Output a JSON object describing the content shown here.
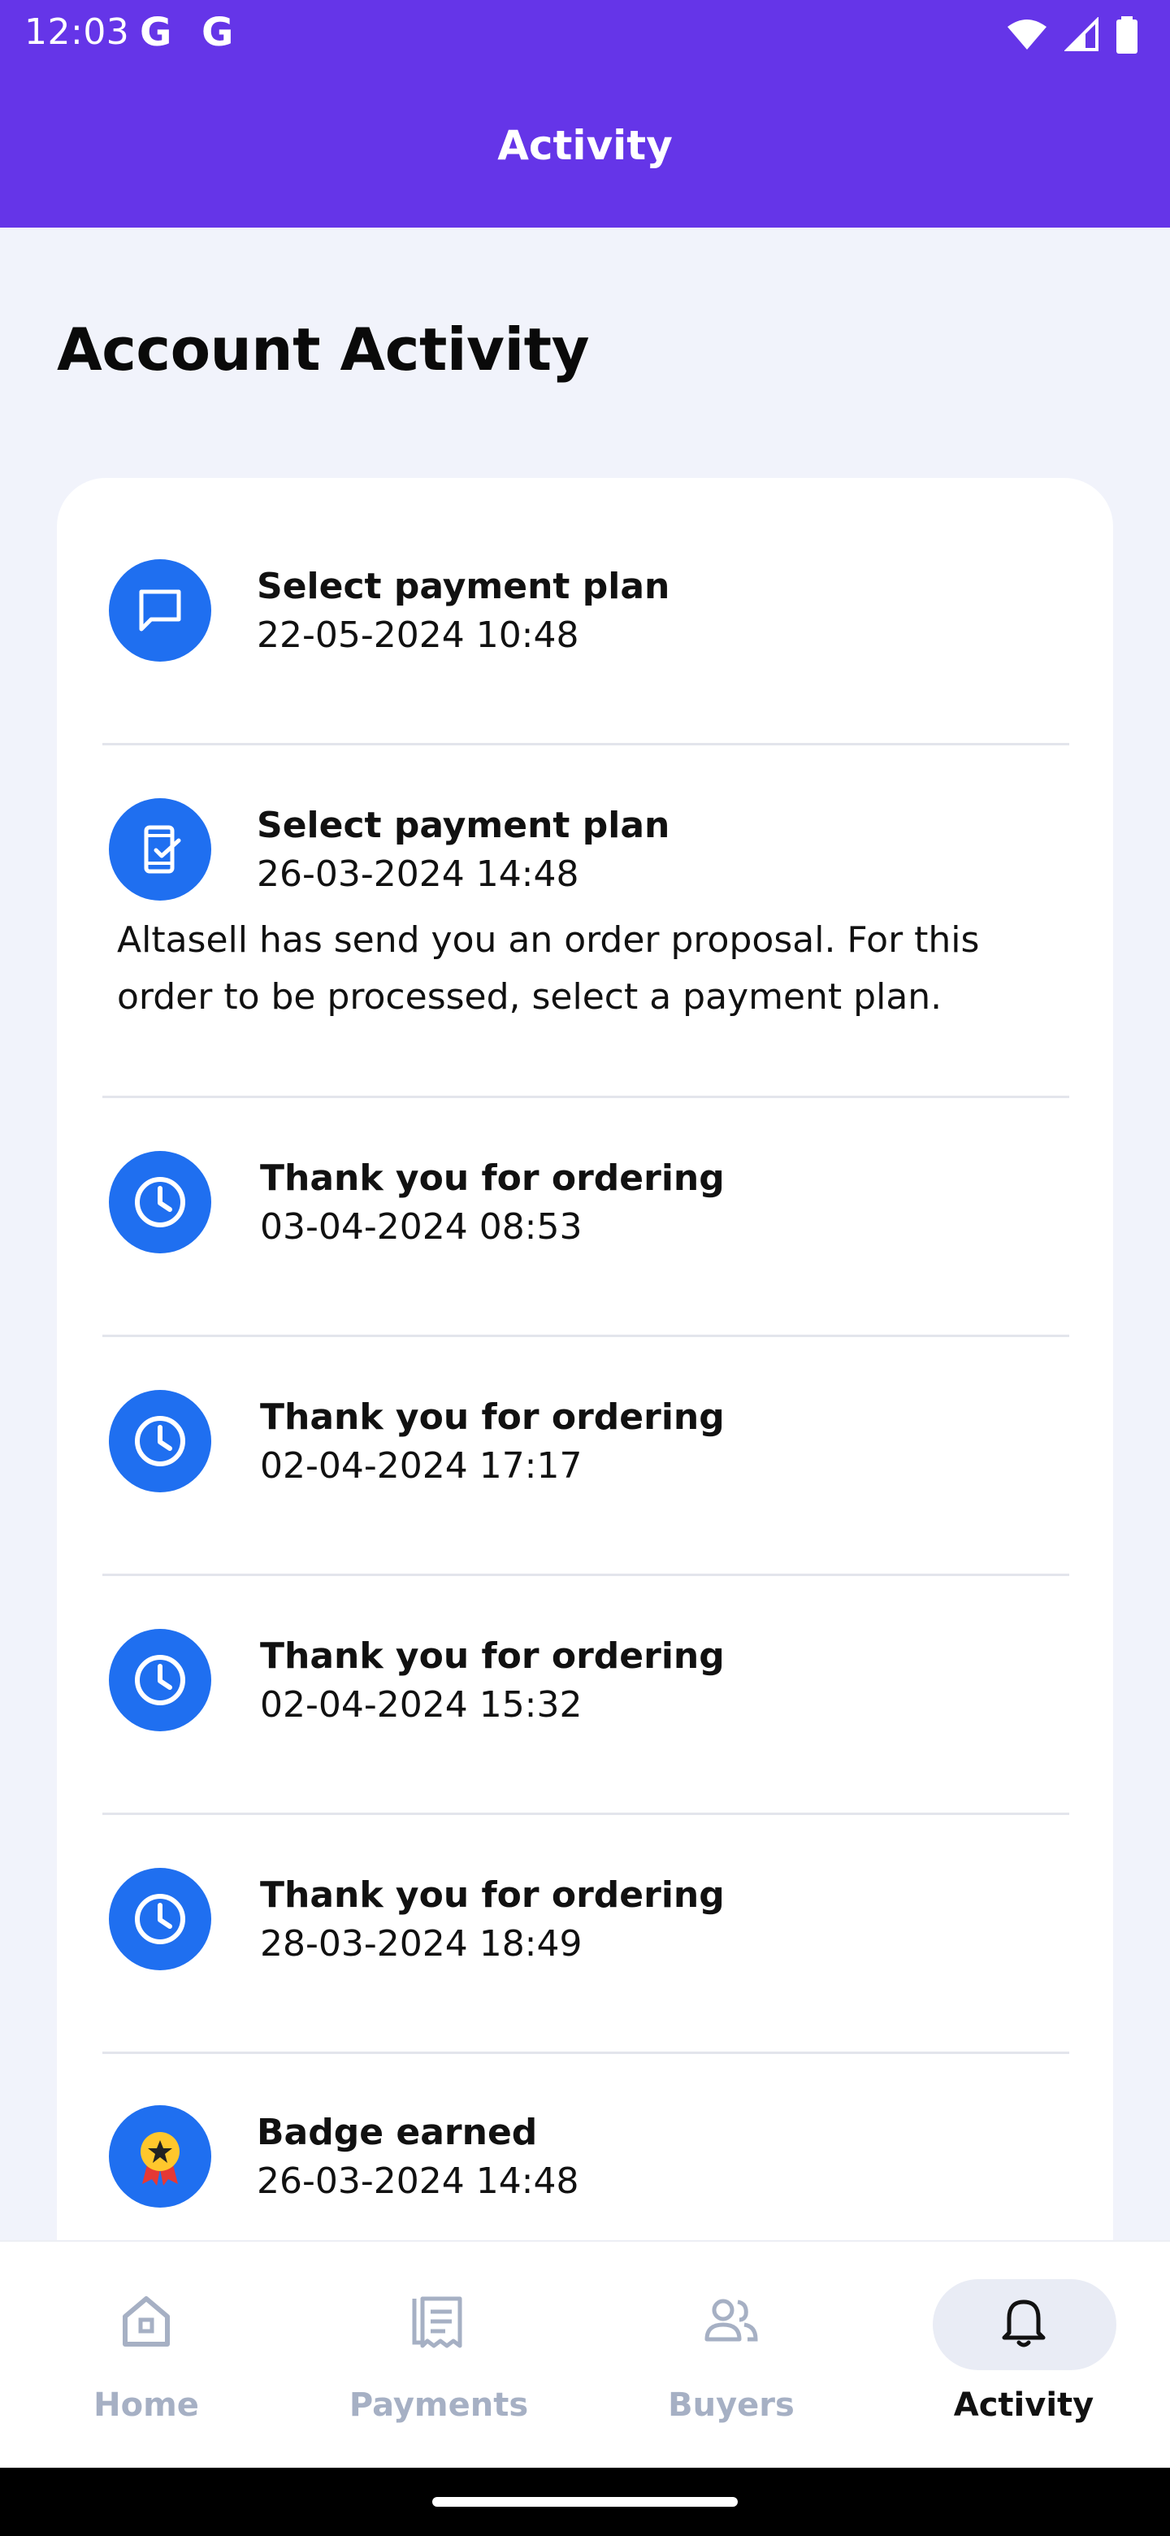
{
  "status_bar": {
    "time": "12:03",
    "google_icons": [
      "G",
      "G"
    ]
  },
  "header": {
    "title": "Activity",
    "color": "#6535e8"
  },
  "page": {
    "section_title": "Account Activity"
  },
  "activities": [
    {
      "icon": "chat-icon",
      "title": "Select payment plan",
      "date": "22-05-2024 10:48"
    },
    {
      "icon": "phone-check-icon",
      "title": "Select payment plan",
      "date": "26-03-2024 14:48",
      "description": "Altasell has send you an order proposal. For this order to be processed, select a payment plan."
    },
    {
      "icon": "clock-icon",
      "title": "Thank you for ordering",
      "date": "03-04-2024 08:53"
    },
    {
      "icon": "clock-icon",
      "title": "Thank you for ordering",
      "date": "02-04-2024 17:17"
    },
    {
      "icon": "clock-icon",
      "title": "Thank you for ordering",
      "date": "02-04-2024 15:32"
    },
    {
      "icon": "clock-icon",
      "title": "Thank you for ordering",
      "date": "28-03-2024 18:49"
    },
    {
      "icon": "badge-icon",
      "title": "Badge earned",
      "date": "26-03-2024 14:48"
    }
  ],
  "nav": {
    "items": [
      {
        "label": "Home",
        "icon": "home-icon"
      },
      {
        "label": "Payments",
        "icon": "receipt-icon"
      },
      {
        "label": "Buyers",
        "icon": "people-icon"
      },
      {
        "label": "Activity",
        "icon": "bell-icon",
        "active": true
      }
    ]
  },
  "colors": {
    "accent_blue": "#1f6ff0",
    "background": "#f1f3fb",
    "nav_inactive": "#a6b0c4"
  }
}
